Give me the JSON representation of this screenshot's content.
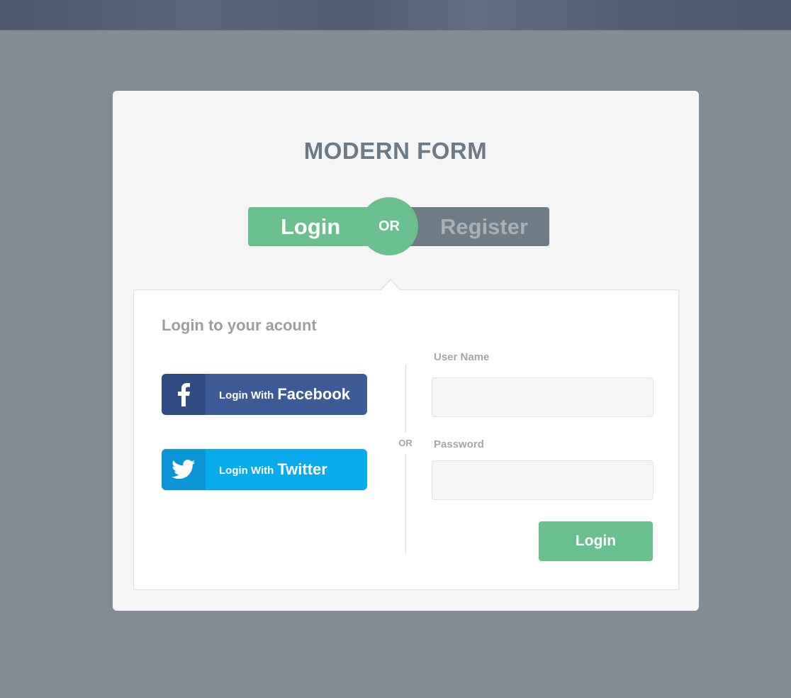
{
  "colors": {
    "background": "#838c92",
    "accent_green": "#6abf8e",
    "register_tab": "#707c85",
    "facebook": "#3d5b97",
    "twitter": "#0aabec"
  },
  "form": {
    "title": "MODERN FORM",
    "tabs": {
      "login": "Login",
      "or": "OR",
      "register": "Register",
      "active": "login"
    }
  },
  "panel": {
    "heading": "Login to your acount",
    "social": {
      "facebook": {
        "prefix": "Login With",
        "brand": "Facebook",
        "icon": "facebook-icon"
      },
      "twitter": {
        "prefix": "Login With",
        "brand": "Twitter",
        "icon": "twitter-icon"
      }
    },
    "divider_label": "OR",
    "fields": {
      "username": {
        "label": "User Name",
        "value": "",
        "placeholder": ""
      },
      "password": {
        "label": "Password",
        "value": "",
        "placeholder": ""
      }
    },
    "submit_label": "Login"
  }
}
